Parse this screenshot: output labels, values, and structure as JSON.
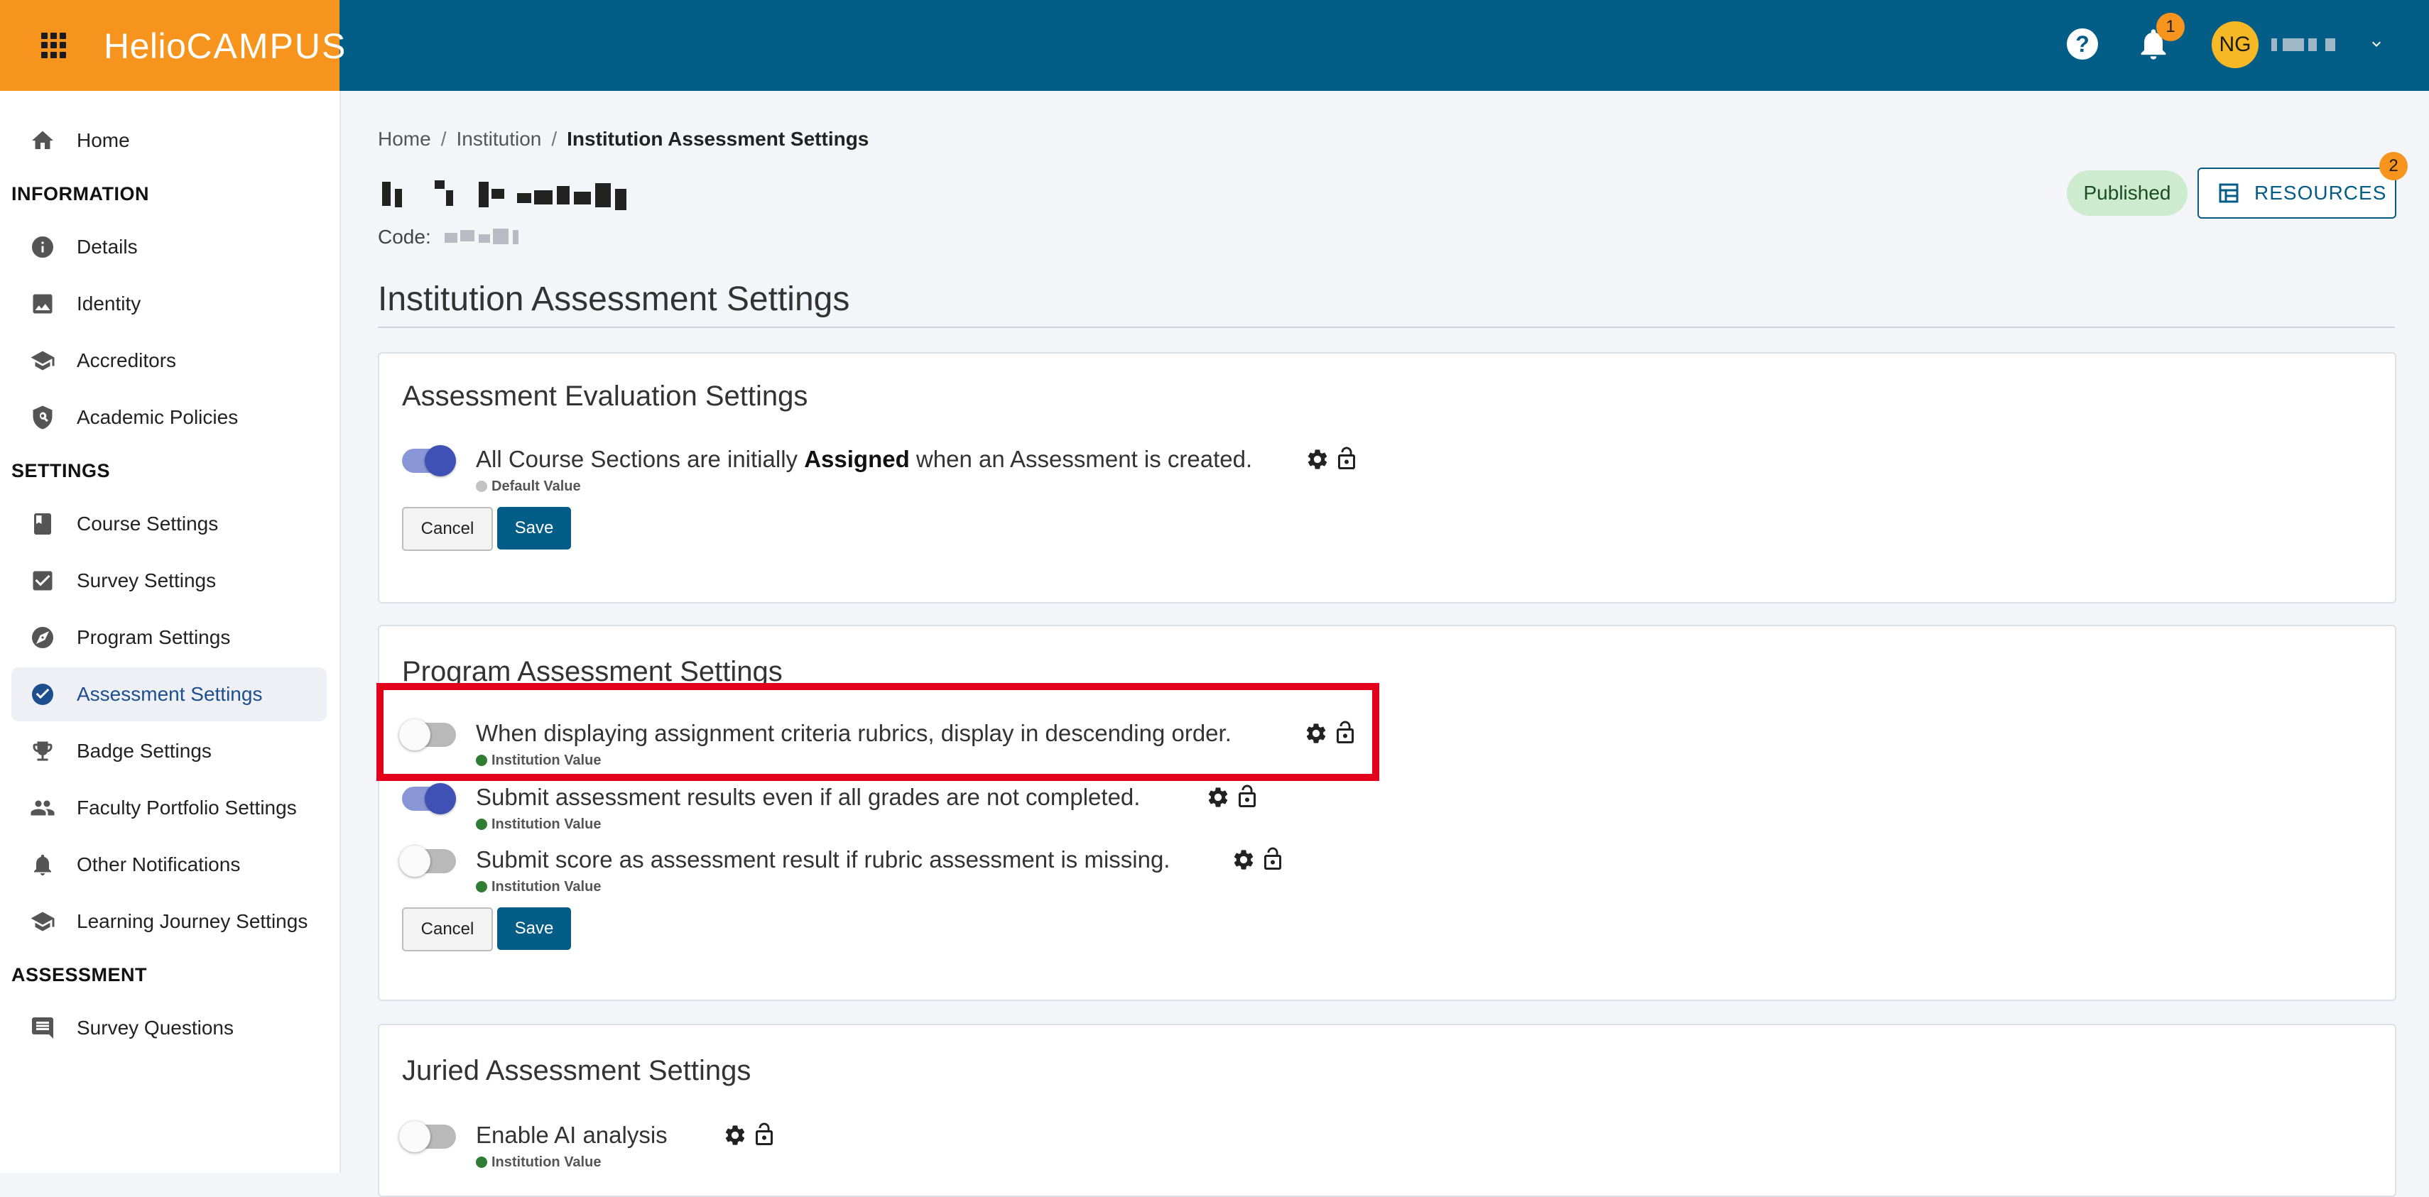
{
  "brand": {
    "logo_part1": "Helio",
    "logo_part2": "CAMPUS"
  },
  "header": {
    "help_label": "?",
    "notification_count": "1",
    "avatar_initials": "NG"
  },
  "sidebar": {
    "items": [
      {
        "label": "Home",
        "icon": "home-icon"
      },
      {
        "label": "Details",
        "icon": "info-icon"
      },
      {
        "label": "Identity",
        "icon": "image-icon"
      },
      {
        "label": "Accreditors",
        "icon": "school-icon"
      },
      {
        "label": "Academic Policies",
        "icon": "policy-icon"
      },
      {
        "label": "Course Settings",
        "icon": "book-icon"
      },
      {
        "label": "Survey Settings",
        "icon": "checkbox-icon"
      },
      {
        "label": "Program Settings",
        "icon": "compass-icon"
      },
      {
        "label": "Assessment Settings",
        "icon": "check-circle-icon"
      },
      {
        "label": "Badge Settings",
        "icon": "trophy-icon"
      },
      {
        "label": "Faculty Portfolio Settings",
        "icon": "people-icon"
      },
      {
        "label": "Other Notifications",
        "icon": "bell-icon"
      },
      {
        "label": "Learning Journey Settings",
        "icon": "school-icon"
      },
      {
        "label": "Survey Questions",
        "icon": "comment-icon"
      }
    ],
    "sections": [
      "INFORMATION",
      "SETTINGS",
      "ASSESSMENT"
    ]
  },
  "breadcrumb": {
    "home": "Home",
    "institution": "Institution",
    "current": "Institution Assessment Settings"
  },
  "code_label": "Code:",
  "status_badge": "Published",
  "resources": {
    "label": "RESOURCES",
    "count": "2"
  },
  "page_title": "Institution Assessment Settings",
  "cards": {
    "evaluation": {
      "title": "Assessment Evaluation Settings",
      "setting1": {
        "before": "All Course Sections are initially ",
        "bold": "Assigned",
        "after": " when an Assessment is created.",
        "source": "Default Value"
      },
      "cancel": "Cancel",
      "save": "Save"
    },
    "program": {
      "title": "Program Assessment Settings",
      "setting1": {
        "text": "When displaying assignment criteria rubrics, display in descending order.",
        "source": "Institution Value"
      },
      "setting2": {
        "text": "Submit assessment results even if all grades are not completed.",
        "source": "Institution Value"
      },
      "setting3": {
        "text": "Submit score as assessment result if rubric assessment is missing.",
        "source": "Institution Value"
      },
      "cancel": "Cancel",
      "save": "Save"
    },
    "juried": {
      "title": "Juried Assessment Settings",
      "setting1": {
        "text": "Enable AI analysis",
        "source": "Institution Value"
      }
    }
  },
  "colors": {
    "topbar": "#045d86",
    "brand": "#f7941d",
    "toggle_on": "#3f51b5",
    "highlight": "#e3001b"
  }
}
